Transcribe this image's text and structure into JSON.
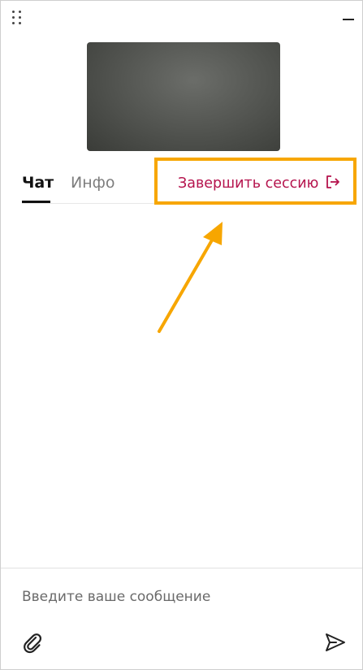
{
  "window": {
    "drag_icon": "drag-handle-icon",
    "minimize_icon": "minimize-icon"
  },
  "tabs": [
    {
      "label": "Чат",
      "active": true
    },
    {
      "label": "Инфо",
      "active": false
    }
  ],
  "end_session": {
    "label": "Завершить сессию",
    "icon": "exit-icon",
    "color": "#b5134d"
  },
  "annotation": {
    "color": "#f7a600"
  },
  "composer": {
    "placeholder": "Введите ваше сообщение",
    "attach_icon": "paperclip-icon",
    "send_icon": "send-icon"
  }
}
